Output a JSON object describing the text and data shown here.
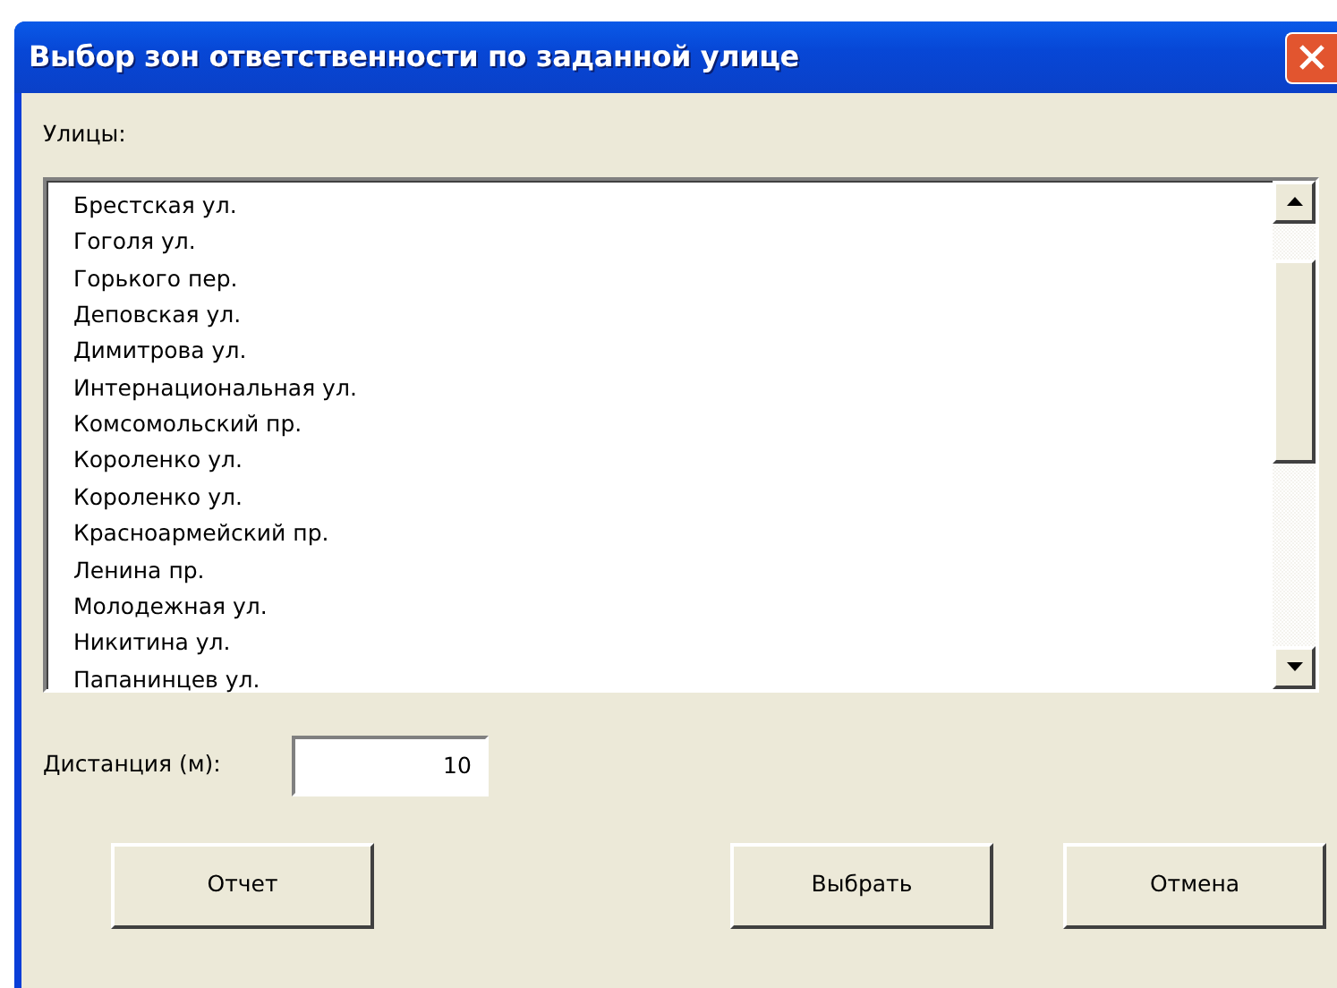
{
  "window": {
    "title": "Выбор зон ответственности по заданной  улице"
  },
  "streets": {
    "label": "Улицы:",
    "items": [
      "Брестская ул.",
      "Гоголя ул.",
      "Горького пер.",
      "Деповская ул.",
      "Димитрова ул.",
      "Интернациональная ул.",
      "Комсомольский пр.",
      "Короленко ул.",
      "Короленко ул.",
      "Красноармейский пр.",
      "Ленина пр.",
      "Молодежная ул.",
      "Никитина ул.",
      "Папанинцев ул."
    ]
  },
  "distance": {
    "label": "Дистанция (м):",
    "value": "10"
  },
  "buttons": [
    {
      "label": "Отчет"
    },
    {
      "label": "Выбрать"
    },
    {
      "label": "Отмена"
    }
  ]
}
